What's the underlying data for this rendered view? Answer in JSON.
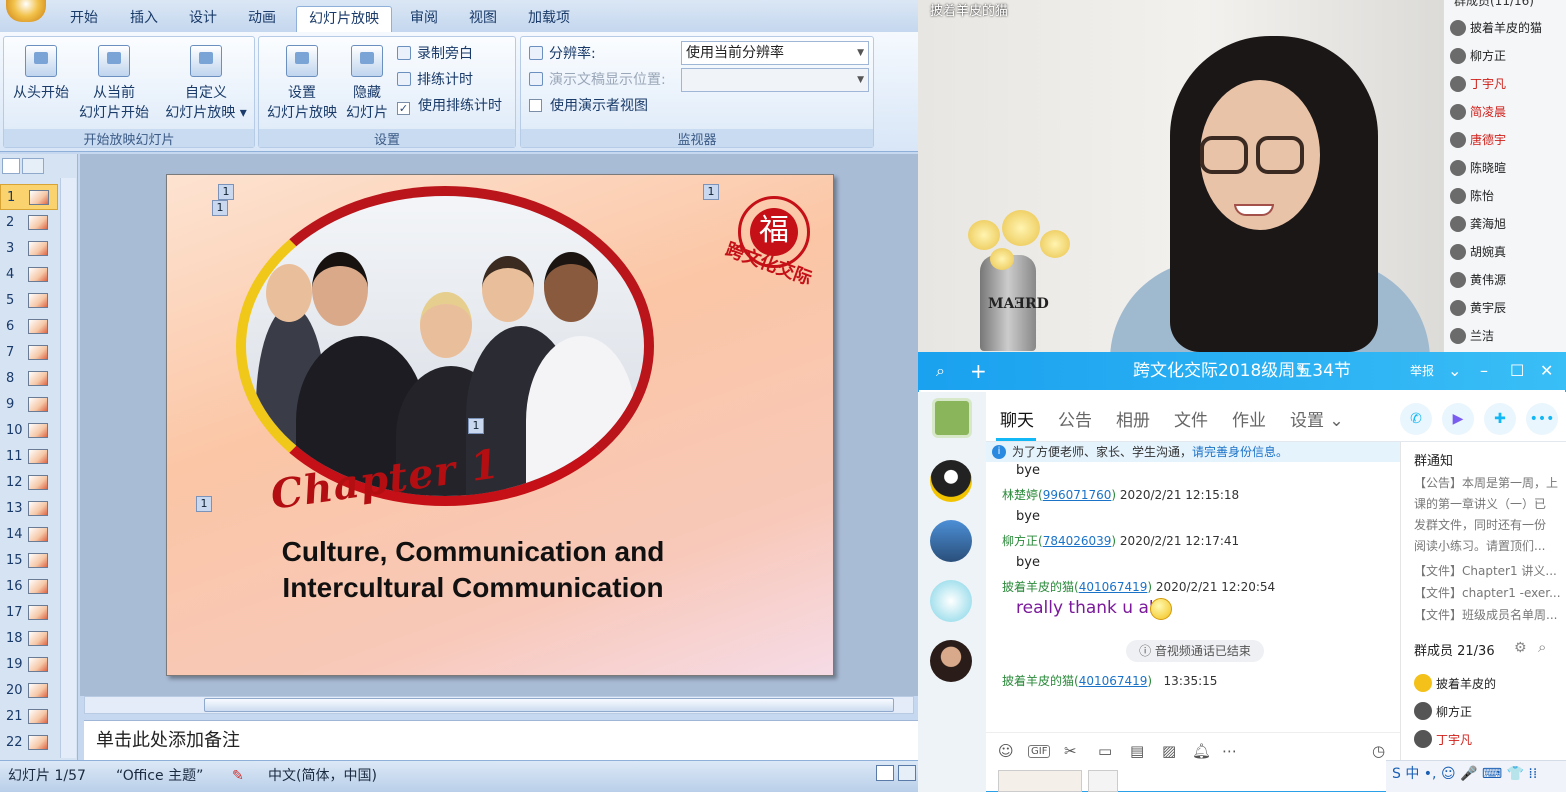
{
  "ppt": {
    "tabs": [
      "开始",
      "插入",
      "设计",
      "动画",
      "幻灯片放映",
      "审阅",
      "视图",
      "加载项"
    ],
    "active_tab_index": 4,
    "groups": {
      "start": {
        "title": "开始放映幻灯片",
        "btn1": "从头开始",
        "btn2_l1": "从当前",
        "btn2_l2": "幻灯片开始",
        "btn3_l1": "自定义",
        "btn3_l2": "幻灯片放映 ▾"
      },
      "setup": {
        "title": "设置",
        "btn1_l1": "设置",
        "btn1_l2": "幻灯片放映",
        "btn2_l1": "隐藏",
        "btn2_l2": "幻灯片",
        "record": "录制旁白",
        "rehearse": "排练计时",
        "use_timing": "使用排练计时"
      },
      "monitor": {
        "title": "监视器",
        "resolution_label": "分辨率:",
        "resolution_value": "使用当前分辨率",
        "show_on_label": "演示文稿显示位置:",
        "presenter_view": "使用演示者视图"
      }
    },
    "thumbnails": [
      "1",
      "2",
      "3",
      "4",
      "5",
      "6",
      "7",
      "8",
      "9",
      "10",
      "11",
      "12",
      "13",
      "14",
      "15",
      "16",
      "17",
      "18",
      "19",
      "20",
      "21",
      "22"
    ],
    "selected_thumbnail": "1",
    "slide": {
      "chapter": "Chapter 1",
      "title_line1": "Culture, Communication and",
      "title_line2": "Intercultural Communication",
      "seal_char": "福",
      "seal_text": "跨文化交际",
      "marker": "1"
    },
    "notes_placeholder": "单击此处添加备注",
    "status": {
      "slide": "幻灯片 1/57",
      "theme": "“Office 主题”",
      "language": "中文(简体，中国)"
    }
  },
  "video": {
    "name": "披着羊皮的猫",
    "vase_text": "MAƎRD"
  },
  "member_list": {
    "header": "群成员(11/16)",
    "members": [
      {
        "name": "披着羊皮的猫",
        "color": "#222222"
      },
      {
        "name": "柳方正",
        "color": "#222222"
      },
      {
        "name": "丁宇凡",
        "color": "#d0201a"
      },
      {
        "name": "简凌晨",
        "color": "#d0201a"
      },
      {
        "name": "唐德宇",
        "color": "#d0201a"
      },
      {
        "name": "陈晓暄",
        "color": "#222222"
      },
      {
        "name": "陈怡",
        "color": "#222222"
      },
      {
        "name": "龚海旭",
        "color": "#222222"
      },
      {
        "name": "胡婉真",
        "color": "#222222"
      },
      {
        "name": "黄伟源",
        "color": "#222222"
      },
      {
        "name": "黄宇辰",
        "color": "#222222"
      },
      {
        "name": "兰洁",
        "color": "#222222"
      }
    ]
  },
  "qq": {
    "title": "跨文化交际2018级周五34节",
    "report": "举报",
    "tabs": [
      "聊天",
      "公告",
      "相册",
      "文件",
      "作业",
      "设置 ⌄"
    ],
    "notice": "为了方便老师、家长、学生沟通，",
    "notice_link": "请完善身份信息。",
    "messages": [
      {
        "text": "bye"
      },
      {
        "sender": "林楚婷",
        "qq": "996071760",
        "time": "2020/2/21 12:15:18",
        "text": "bye"
      },
      {
        "sender": "柳方正",
        "qq": "784026039",
        "time": "2020/2/21 12:17:41",
        "text": "bye"
      },
      {
        "sender": "披着羊皮的猫",
        "qq": "401067419",
        "time": "2020/2/21 12:20:54",
        "text": "really thank u all"
      },
      {
        "sender": "披着羊皮的猫",
        "qq": "401067419",
        "time": "13:35:15"
      }
    ],
    "call_ended": "音视频通话已结束",
    "group_notice_title": "群通知",
    "group_notice_lines": [
      "【公告】本周是第一周，上",
      "课的第一章讲义（一）已",
      "发群文件，同时还有一份",
      "阅读小练习。请置顶们..."
    ],
    "files": [
      "【文件】Chapter1 讲义...",
      "【文件】chapter1 -exer...",
      "【文件】班级成员名单周..."
    ],
    "members_title": "群成员 21/36",
    "side_members": [
      {
        "name": "披着羊皮的",
        "color": "#222222"
      },
      {
        "name": "柳方正",
        "color": "#222222"
      },
      {
        "name": "丁宇凡",
        "color": "#d0201a"
      }
    ],
    "ime": "S 中 •, ☺ 🎤 ⌨ 👕 ⁞⁞"
  }
}
